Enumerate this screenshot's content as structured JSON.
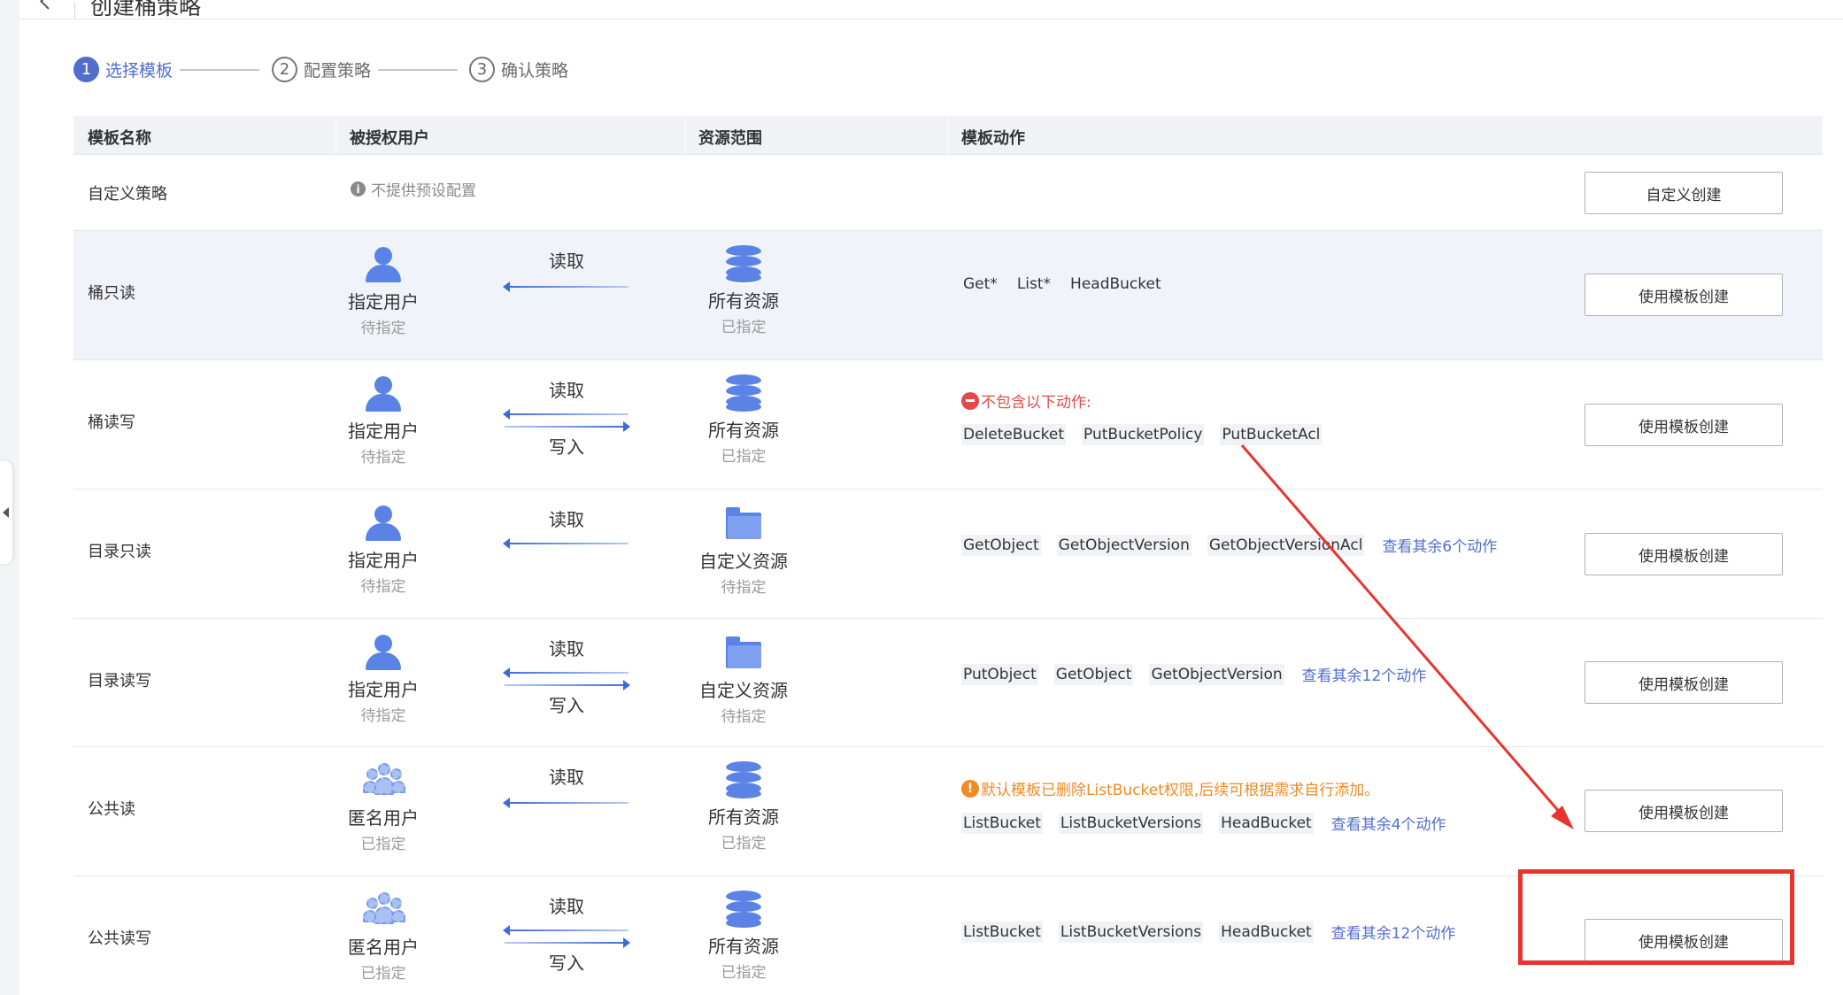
{
  "header": {
    "title": "创建桶策略"
  },
  "steps": [
    {
      "num": "1",
      "label": "选择模板",
      "active": true
    },
    {
      "num": "2",
      "label": "配置策略",
      "active": false
    },
    {
      "num": "3",
      "label": "确认策略",
      "active": false
    }
  ],
  "table": {
    "headers": {
      "name": "模板名称",
      "principal": "被授权用户",
      "resource": "资源范围",
      "action": "模板动作"
    },
    "custom_row": {
      "name": "自定义策略",
      "hint": "不提供预设配置",
      "button": "自定义创建"
    },
    "rows": [
      {
        "name": "桶只读",
        "principal": {
          "name": "指定用户",
          "status": "待指定"
        },
        "flow": {
          "read": "读取"
        },
        "resource": {
          "name": "所有资源",
          "status": "已指定"
        },
        "actions": [
          "Get*",
          "List*",
          "HeadBucket"
        ],
        "button": "使用模板创建"
      },
      {
        "name": "桶读写",
        "principal": {
          "name": "指定用户",
          "status": "待指定"
        },
        "flow": {
          "read": "读取",
          "write": "写入"
        },
        "resource": {
          "name": "所有资源",
          "status": "已指定"
        },
        "note": "不包含以下动作:",
        "actions": [
          "DeleteBucket",
          "PutBucketPolicy",
          "PutBucketAcl"
        ],
        "button": "使用模板创建"
      },
      {
        "name": "目录只读",
        "principal": {
          "name": "指定用户",
          "status": "待指定"
        },
        "flow": {
          "read": "读取"
        },
        "resource": {
          "name": "自定义资源",
          "status": "待指定"
        },
        "actions": [
          "GetObject",
          "GetObjectVersion",
          "GetObjectVersionAcl"
        ],
        "more": "查看其余6个动作",
        "button": "使用模板创建"
      },
      {
        "name": "目录读写",
        "principal": {
          "name": "指定用户",
          "status": "待指定"
        },
        "flow": {
          "read": "读取",
          "write": "写入"
        },
        "resource": {
          "name": "自定义资源",
          "status": "待指定"
        },
        "actions": [
          "PutObject",
          "GetObject",
          "GetObjectVersion"
        ],
        "more": "查看其余12个动作",
        "button": "使用模板创建"
      },
      {
        "name": "公共读",
        "principal": {
          "name": "匿名用户",
          "status": "已指定"
        },
        "flow": {
          "read": "读取"
        },
        "resource": {
          "name": "所有资源",
          "status": "已指定"
        },
        "warning": "默认模板已删除ListBucket权限,后续可根据需求自行添加。",
        "actions": [
          "ListBucket",
          "ListBucketVersions",
          "HeadBucket"
        ],
        "more": "查看其余4个动作",
        "button": "使用模板创建"
      },
      {
        "name": "公共读写",
        "principal": {
          "name": "匿名用户",
          "status": "已指定"
        },
        "flow": {
          "read": "读取",
          "write": "写入"
        },
        "resource": {
          "name": "所有资源",
          "status": "已指定"
        },
        "actions": [
          "ListBucket",
          "ListBucketVersions",
          "HeadBucket"
        ],
        "more": "查看其余12个动作",
        "button": "使用模板创建"
      }
    ]
  },
  "annotation": {
    "color": "#e8342f"
  },
  "colors": {
    "accent": "#526ecc",
    "icon": "#5b83e6",
    "error": "#e04a4a",
    "warning": "#f08a24"
  }
}
